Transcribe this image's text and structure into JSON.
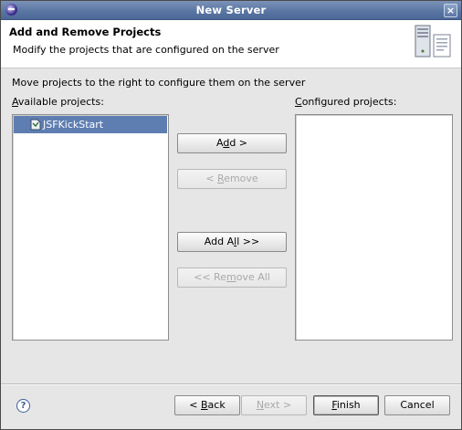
{
  "window": {
    "title": "New Server"
  },
  "header": {
    "title": "Add and Remove Projects",
    "description": "Modify the projects that are configured on the server"
  },
  "instruction": "Move projects to the right to configure them on the server",
  "available": {
    "label_prefix": "A",
    "label_rest": "vailable projects:",
    "items": [
      {
        "label": "JSFKickStart",
        "selected": true,
        "icon": "project-icon"
      }
    ]
  },
  "configured": {
    "label_prefix": "C",
    "label_rest": "onfigured projects:",
    "items": []
  },
  "buttons": {
    "add": {
      "a": "A",
      "u": "d",
      "b": "d >"
    },
    "remove": {
      "a": "< ",
      "u": "R",
      "b": "emove"
    },
    "add_all": {
      "a": "Add A",
      "u": "l",
      "b": "l >>"
    },
    "remove_all": {
      "a": "<< Re",
      "u": "m",
      "b": "ove All"
    },
    "back": {
      "a": "< ",
      "u": "B",
      "b": "ack"
    },
    "next": {
      "a": "",
      "u": "N",
      "b": "ext >"
    },
    "finish": {
      "a": "",
      "u": "F",
      "b": "inish"
    },
    "cancel": {
      "a": "Cancel",
      "u": "",
      "b": ""
    }
  },
  "colors": {
    "selection": "#5e7eb2",
    "titlebar": "#5a76a3"
  },
  "icons": {
    "close": "close-icon",
    "help": "help-icon",
    "banner": "server-graphic"
  }
}
